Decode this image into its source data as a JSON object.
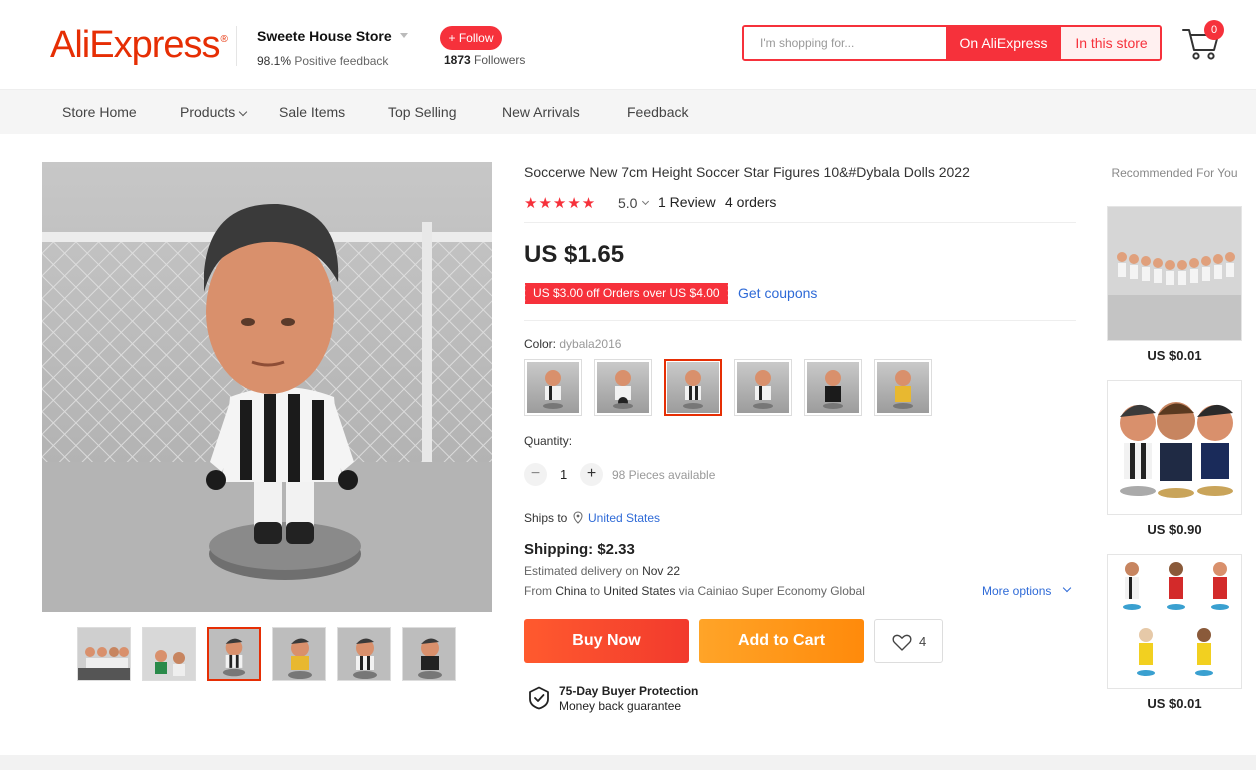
{
  "header": {
    "logo_text": "AliExpress",
    "logo_reg": "®",
    "store_name": "Sweete House Store",
    "positive_feedback_pct": "98.1%",
    "positive_feedback_label": "Positive feedback",
    "follow_label": "+ Follow",
    "followers_count": "1873",
    "followers_label": "Followers",
    "search_placeholder": "I'm shopping for...",
    "search_on_ali_label": "On AliExpress",
    "search_in_store_label": "In this store",
    "cart_count": "0"
  },
  "nav": {
    "items": [
      "Store Home",
      "Products",
      "Sale Items",
      "Top Selling",
      "New Arrivals",
      "Feedback"
    ]
  },
  "product": {
    "title": "Soccerwe New 7cm Height Soccer Star Figures 10&#Dybala Dolls 2022",
    "stars": "★★★★★",
    "rating": "5.0",
    "reviews": "1 Review",
    "orders": "4 orders",
    "price": "US $1.65",
    "coupon_text": "US $3.00 off Orders over US $4.00",
    "get_coupons_label": "Get coupons",
    "color_label": "Color:",
    "color_value": "dybala2016",
    "quantity_label": "Quantity:",
    "quantity_minus": "−",
    "quantity_plus": "+",
    "quantity_value": "1",
    "pieces_available": "98 Pieces available",
    "ships_to_label": "Ships to",
    "ships_to_country": "United States",
    "shipping_price": "Shipping: $2.33",
    "delivery_label": "Estimated delivery on",
    "delivery_date": "Nov 22",
    "route_from_label": "From",
    "route_from": "China",
    "route_to_label": "to",
    "route_to": "United States",
    "route_via": "via Cainiao Super Economy Global",
    "more_options_label": "More options",
    "buy_now_label": "Buy Now",
    "add_to_cart_label": "Add to Cart",
    "wishlist_count": "4",
    "protection_title": "75-Day Buyer Protection",
    "protection_sub": "Money back guarantee"
  },
  "gallery": {
    "selected_thumb_index": 2,
    "thumb_count": 6,
    "selected_swatch_index": 2,
    "swatch_count": 6
  },
  "recommended": {
    "title": "Recommended For You",
    "items": [
      {
        "price": "US $0.01"
      },
      {
        "price": "US $0.90"
      },
      {
        "price": "US $0.01"
      }
    ]
  },
  "colors": {
    "brand_red": "#e62e04",
    "accent_red": "#f6313b",
    "orange": "#ff8a0b",
    "link_blue": "#2e6ad7"
  }
}
